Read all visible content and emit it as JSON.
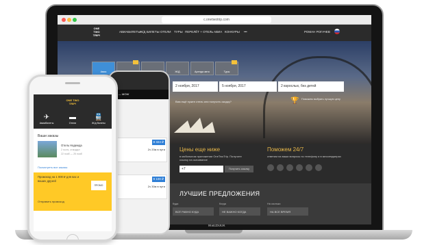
{
  "laptop": {
    "brand": "MacBook",
    "browser": {
      "url": "c.onetwotrip.com"
    },
    "site": {
      "logo": "ONE TWO TRIP!",
      "nav": [
        "АВИАБИЛЕТЫ",
        "Ж/Д БИЛЕТЫ",
        "ОТЕЛИ",
        "ТУРЫ",
        "ПЕРЕЛЁТ + ОТЕЛЬ",
        "АВИА",
        "КОНКУРЫ",
        "•••"
      ],
      "user": "РОМАН РОГАЧЕВ",
      "tabs": [
        "Авиа",
        "Перелёт + отель",
        "Авиабилеты",
        "Ж/Д",
        "Аренда авто",
        "Туры"
      ],
      "search": {
        "from": "2 ноября, 2017",
        "to": "5 ноября, 2017",
        "guests": "2 взрослых, без детей"
      },
      "promo_question": "Вам ещё нужен отель или получить скидку?",
      "promo_badge": "Поможем выбрать лучшую цену",
      "price_block": {
        "title": "Цены еще ниже",
        "text": "в мобильном приложении OneTwoTrip. Получите ссылку на скачивание",
        "phone": "+7",
        "button": "Получить ссылку"
      },
      "help_block": {
        "title": "Поможем 24/7",
        "text": "ответим на ваши вопросы по телефону и в мессенджерах"
      },
      "offers": {
        "title": "ЛУЧШИЕ ПРЕДЛОЖЕНИЯ",
        "filters": [
          {
            "label": "Куда",
            "value": "ВСЁ РАВНО КУДА"
          },
          {
            "label": "Когда",
            "value": "НЕ ВАЖНО КОГДА"
          },
          {
            "label": "На сколько",
            "value": "НА ВСЕ ВРЕМЯ"
          }
        ]
      }
    }
  },
  "phone_back": {
    "route": "LED — MOW",
    "cards": [
      {
        "price": "8 324 ₽",
        "info": "2ч 20м в пути"
      },
      {
        "price": "9 100 ₽",
        "info": "2ч 30м в пути"
      }
    ]
  },
  "phone_front": {
    "logo": "ONE TWO TRIP!",
    "services": [
      "Авиабилеты",
      "Отели",
      "Ж/д билеты"
    ],
    "orders_title": "Ваши заказы",
    "hotel": {
      "name": "Отель Надежда",
      "sub": "2 гостя, стандарт",
      "date": "22 нояб — 25 нояб"
    },
    "all_orders_link": "Посмотреть все заказы",
    "promo": {
      "text": "Промокод на 1 000 ₽ для вас и ваших друзей",
      "code": "ПРОМО",
      "button": "Отправить промокод"
    }
  }
}
